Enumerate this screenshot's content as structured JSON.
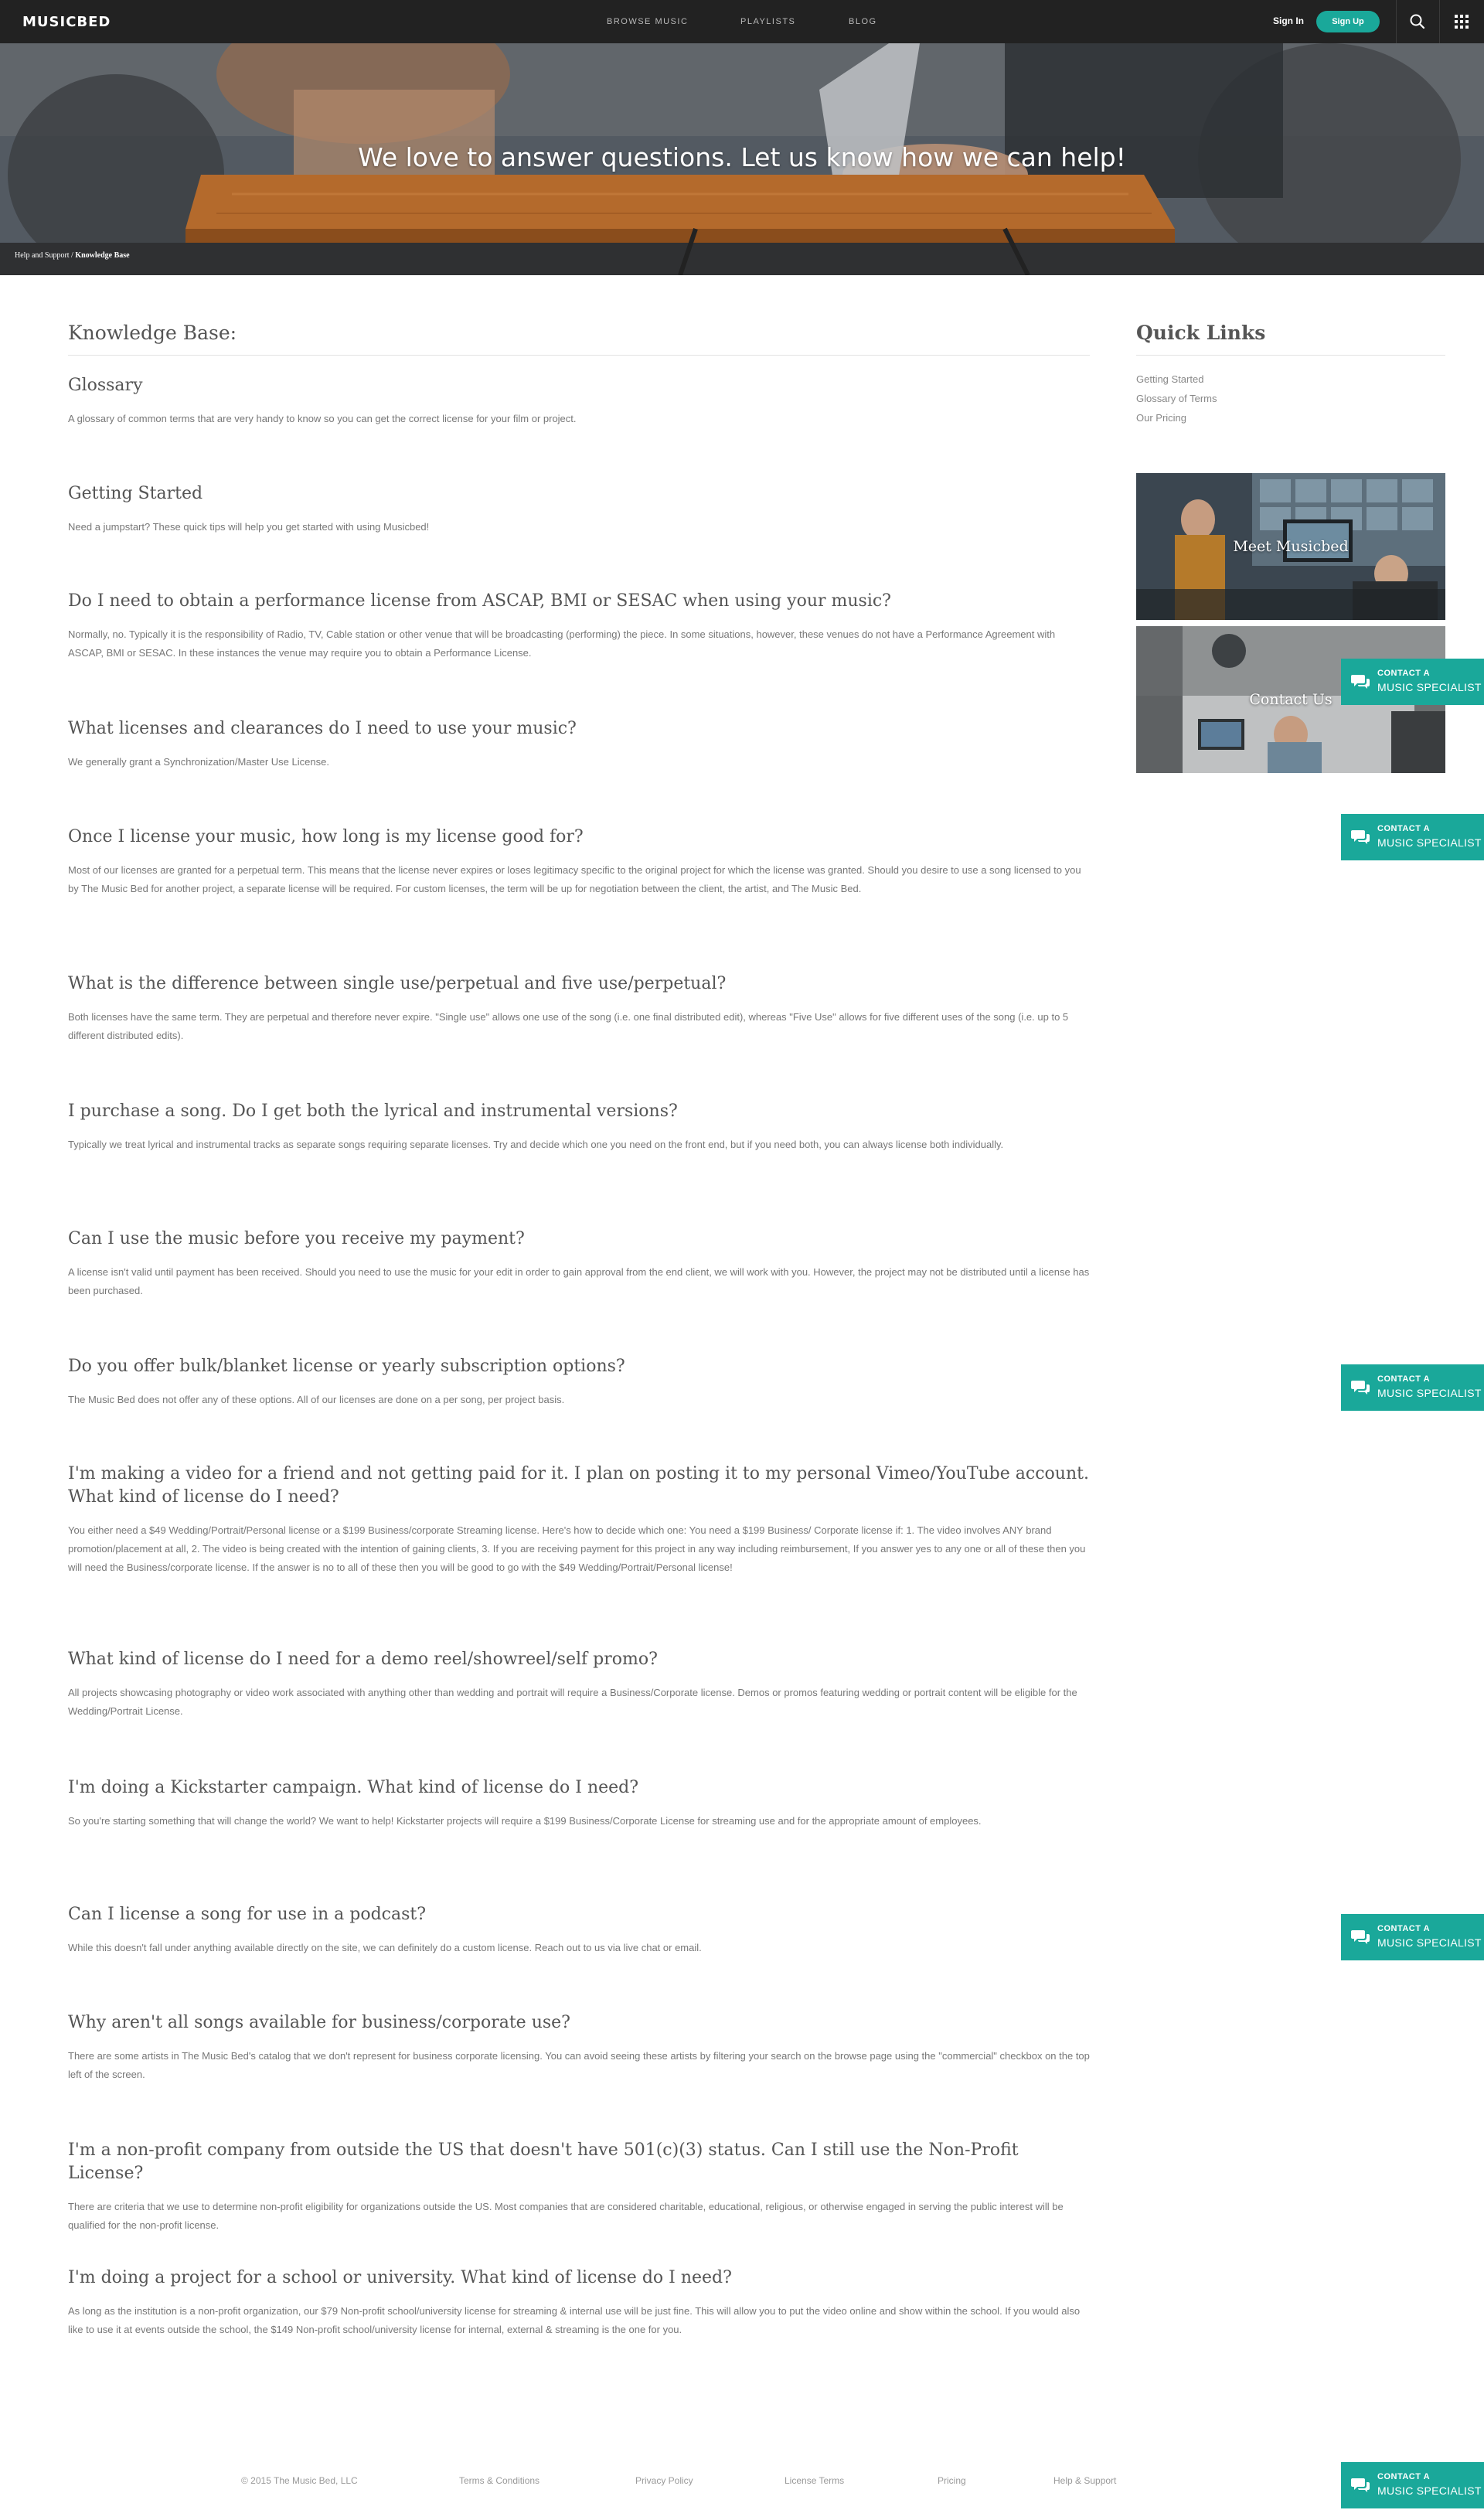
{
  "header": {
    "logo": "MUSICBED",
    "nav": [
      "BROWSE MUSIC",
      "PLAYLISTS",
      "BLOG"
    ],
    "sign_in": "Sign In",
    "sign_up": "Sign Up",
    "icons": [
      "search-icon",
      "grid-menu-icon"
    ]
  },
  "hero": {
    "title": "We love to answer questions. Let us know how we can help!",
    "breadcrumb_link": "Help and Support",
    "breadcrumb_sep": " / ",
    "breadcrumb_current": "Knowledge Base"
  },
  "main": {
    "title": "Knowledge Base:",
    "faqs": [
      {
        "q": "Glossary",
        "a": "A glossary of common terms that are very handy to know so you can get the correct license for your film or project."
      },
      {
        "q": "Getting Started",
        "a": "Need a jumpstart? These quick tips will help you get started with using Musicbed!"
      },
      {
        "q": "Do I need to obtain a performance license from ASCAP, BMI or SESAC when using your music?",
        "a": "Normally, no. Typically it is the responsibility of Radio, TV, Cable station or other venue that will be broadcasting (performing) the piece. In some situations, however, these venues do not have a Performance Agreement with ASCAP, BMI or SESAC. In these instances the venue may require you to obtain a Performance License."
      },
      {
        "q": "What licenses and clearances do I need to use your music?",
        "a": "We generally grant a Synchronization/Master Use License."
      },
      {
        "q": "Once I license your music, how long is my license good for?",
        "a": "Most of our licenses are granted for a perpetual term. This means that the license never expires or loses legitimacy specific to the original project for which the license was granted. Should you desire to use a song licensed to you by The Music Bed for another project, a separate license will be required. For custom licenses, the term will be up for negotiation between the client, the artist, and The Music Bed."
      },
      {
        "q": "What is the difference between single use/perpetual and five use/perpetual?",
        "a": "Both licenses have the same term. They are perpetual and therefore never expire. \"Single use\" allows one use of the song (i.e. one final distributed edit), whereas \"Five Use\" allows for five different uses of the song (i.e. up to 5 different distributed edits)."
      },
      {
        "q": "I purchase a song. Do I get both the lyrical and instrumental versions?",
        "a": "Typically we treat lyrical and instrumental tracks as separate songs requiring separate licenses. Try and decide which one you need on the front end, but if you need both, you can always license both individually."
      },
      {
        "q": "Can I use the music before you receive my payment?",
        "a": "A license isn't valid until payment has been received. Should you need to use the music for your edit in order to gain approval from the end client, we will work with you. However, the project may not be distributed until a license has been purchased."
      },
      {
        "q": "Do you offer bulk/blanket license or yearly subscription options?",
        "a": "The Music Bed does not offer any of these options. All of our licenses are done on a per song, per project basis."
      },
      {
        "q": "I'm making a video for a friend and not getting paid for it. I plan on posting it to my personal Vimeo/YouTube account. What kind of license do I need?",
        "a": "You either need a $49 Wedding/Portrait/Personal license or a $199 Business/corporate Streaming license. Here's how to decide which one: You need a $199 Business/ Corporate license if: 1. The video involves ANY brand promotion/placement at all, 2. The video is being created with the intention of gaining clients, 3. If you are receiving payment for this project in any way including reimbursement, If you answer yes to any one or all of these then you will need the Business/corporate license. If the answer is no to all of these then you will be good to go with the $49 Wedding/Portrait/Personal license!"
      },
      {
        "q": "What kind of license do I need for a demo reel/showreel/self promo?",
        "a": "All projects showcasing photography or video work associated with anything other than wedding and portrait will require a Business/Corporate license. Demos or promos featuring wedding or portrait content will be eligible for the Wedding/Portrait License."
      },
      {
        "q": "I'm doing a Kickstarter campaign. What kind of license do I need?",
        "a": "So you're starting something that will change the world? We want to help! Kickstarter projects will require a $199 Business/Corporate License for streaming use and for the appropriate amount of employees."
      },
      {
        "q": "Can I license a song for use in a podcast?",
        "a": "While this doesn't fall under anything available directly on the site, we can definitely do a custom license. Reach out to us via live chat or email."
      },
      {
        "q": "Why aren't all songs available for business/corporate use?",
        "a": "There are some artists in The Music Bed's catalog that we don't represent for business corporate licensing. You can avoid seeing these artists by filtering your search on the browse page using the \"commercial\" checkbox on the top left of the screen."
      },
      {
        "q": "I'm a non-profit company from outside the US that doesn't have 501(c)(3) status. Can I still use the Non-Profit License?",
        "a": "There are criteria that we use to determine non-profit eligibility for organizations outside the US. Most companies that are considered charitable, educational, religious, or otherwise engaged in serving the public interest will be qualified for the non-profit license."
      },
      {
        "q": "I'm doing a project for a school or university. What kind of license do I need?",
        "a": "As long as the institution is a non-profit organization, our $79 Non-profit school/university license for streaming & internal use will be just fine. This will allow you to put the video online and show within the school. If you would also like to use it at events outside the school, the $149 Non-profit school/university license for internal, external & streaming is the one for you."
      }
    ]
  },
  "sidebar": {
    "title": "Quick Links",
    "links": [
      "Getting Started",
      "Glossary of Terms",
      "Our Pricing"
    ],
    "promos": [
      "Meet Musicbed",
      "Contact Us"
    ]
  },
  "contact_tab": {
    "line1": "CONTACT A",
    "line2": "MUSIC SPECIALIST",
    "icon": "chat-bubbles-icon"
  },
  "footer": {
    "copyright": "© 2015 The Music Bed, LLC",
    "links": [
      "Terms & Conditions",
      "Privacy Policy",
      "License Terms",
      "Pricing",
      "Help & Support"
    ]
  },
  "colors": {
    "nav_bg": "#222222",
    "accent": "#1aa89a"
  }
}
